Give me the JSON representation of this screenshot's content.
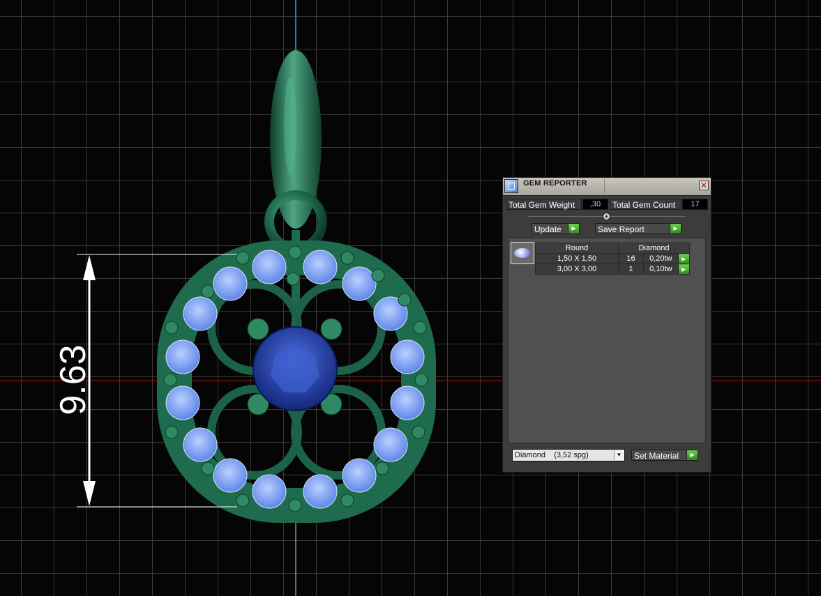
{
  "viewport": {
    "dimension_label": "9.63",
    "colors": {
      "metal": "#1f6b4e",
      "small_stones": "#8fb4ff",
      "center_stone": "#1f3fb0",
      "grid": "#3a3a3a",
      "axis_red": "#a01515",
      "axis_blue": "#2b7a9a"
    }
  },
  "gem_reporter": {
    "title": "GEM REPORTER",
    "close_label": "✕",
    "total_weight_label": "Total Gem Weight",
    "total_weight_value": ",30",
    "total_count_label": "Total Gem Count",
    "total_count_value": "17",
    "update_label": "Update",
    "save_report_label": "Save Report",
    "table": {
      "headers": [
        "Round",
        "Diamond"
      ],
      "rows": [
        {
          "size": "1,50 X 1,50",
          "count": "16",
          "weight": "0,20tw"
        },
        {
          "size": "3,00 X 3,00",
          "count": "1",
          "weight": "0,10tw"
        }
      ]
    },
    "material": {
      "selected": "Diamond    (3,52 spg)"
    },
    "set_material_label": "Set Material",
    "icons": {
      "title": "gem-reporter-icon",
      "go": "green-arrow-icon",
      "gem": "gem-thumbnail-icon"
    }
  }
}
